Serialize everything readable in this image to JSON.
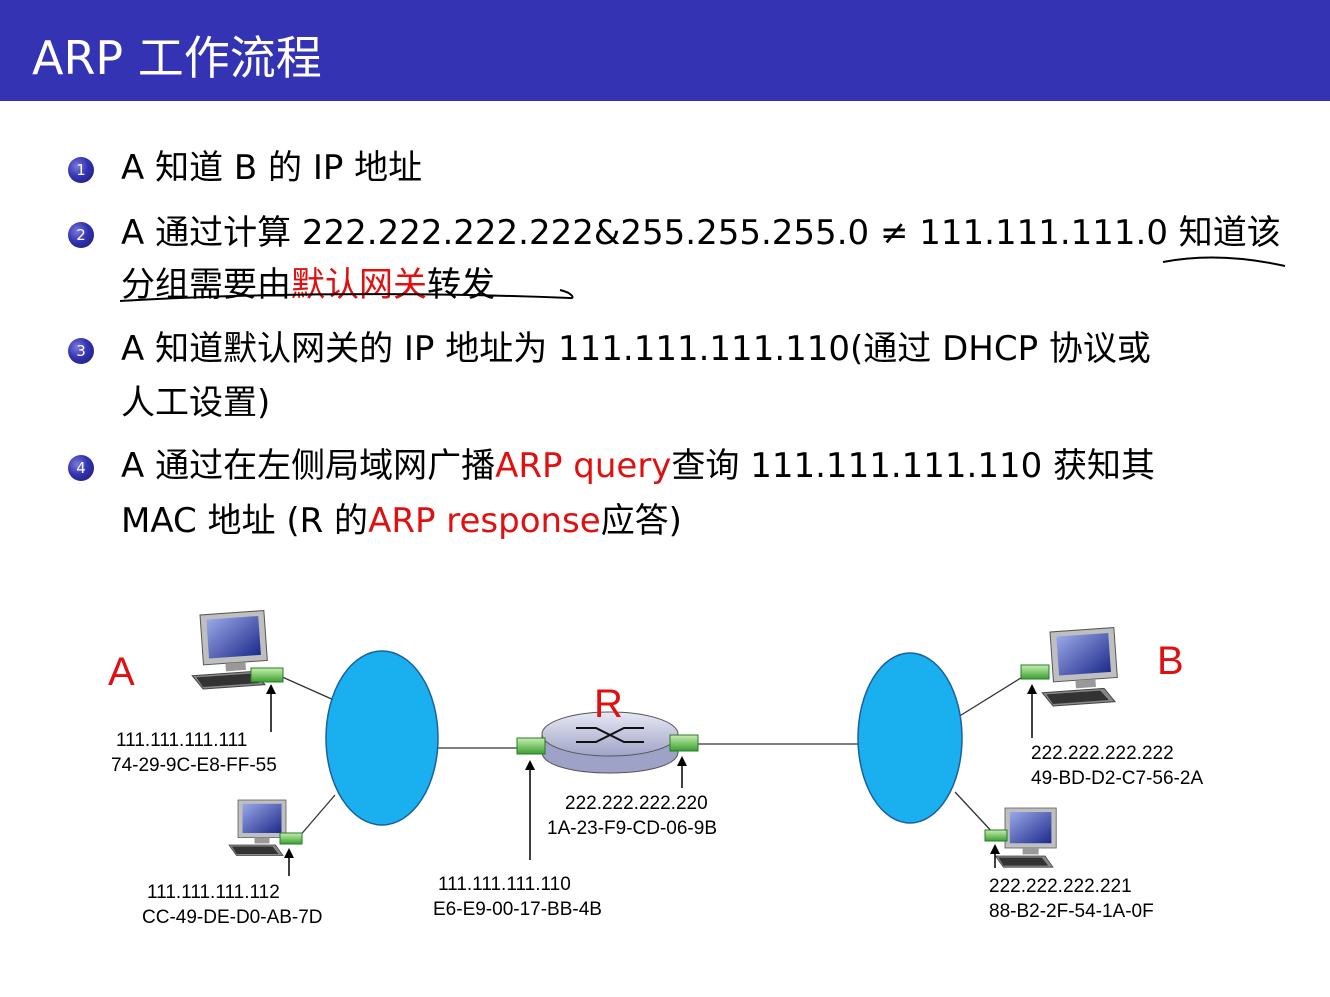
{
  "title": "ARP 工作流程",
  "items": [
    {
      "num": "1",
      "line1": "A 知道 B 的 IP 地址"
    },
    {
      "num": "2",
      "line1": "A 通过计算 222.222.222.222&255.255.255.0 ≠ 111.111.111.0 知道该",
      "line2_a": "分组需要由",
      "line2_red": "默认网关",
      "line2_b": "转发"
    },
    {
      "num": "3",
      "line1": "A 知道默认网关的 IP 地址为 111.111.111.110(通过 DHCP 协议或",
      "line2": "人工设置)"
    },
    {
      "num": "4",
      "line1_a": "A 通过在左侧局域网广播",
      "line1_red": "ARP query",
      "line1_b": "查询 111.111.111.110 获知其",
      "line2_a": "MAC 地址 (R 的",
      "line2_red": "ARP response",
      "line2_b": "应答)"
    }
  ],
  "diagram": {
    "host_a": {
      "label": "A",
      "ip": "111.111.111.111",
      "mac": "74-29-9C-E8-FF-55"
    },
    "host_a2": {
      "ip": "111.111.111.112",
      "mac": "CC-49-DE-D0-AB-7D"
    },
    "router": {
      "label": "R",
      "left_ip": "111.111.111.110",
      "left_mac": "E6-E9-00-17-BB-4B",
      "right_ip": "222.222.222.220",
      "right_mac": "1A-23-F9-CD-06-9B"
    },
    "host_b": {
      "label": "B",
      "ip": "222.222.222.222",
      "mac": "49-BD-D2-C7-56-2A"
    },
    "host_b2": {
      "ip": "222.222.222.221",
      "mac": "88-B2-2F-54-1A-0F"
    }
  },
  "colors": {
    "title_bar": "#3333b3",
    "highlight": "#e01010",
    "cloud": "#1ab0f0"
  }
}
